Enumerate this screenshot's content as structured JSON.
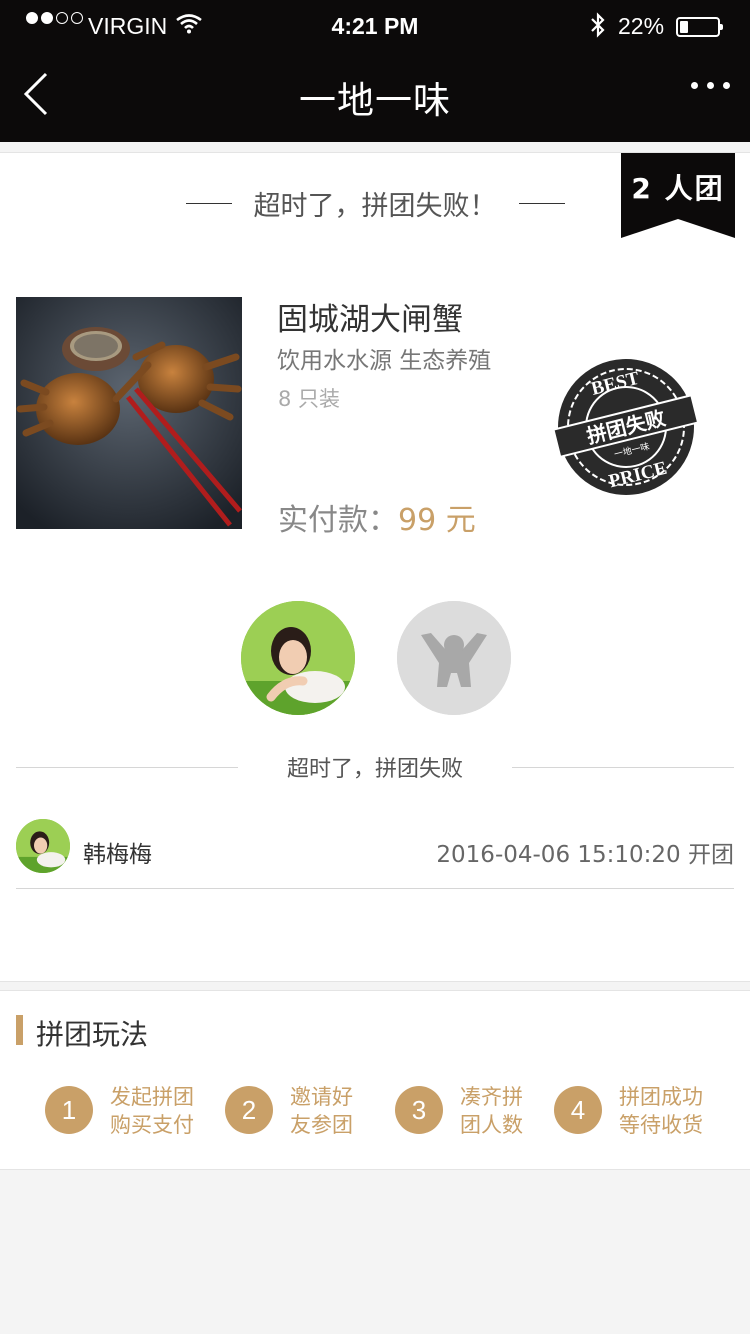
{
  "status_bar": {
    "carrier": "VIRGIN",
    "time": "4:21 PM",
    "battery": "22%",
    "battery_level": 0.22,
    "icons": [
      "signal-dots",
      "wifi-icon",
      "bluetooth-icon",
      "battery-icon"
    ]
  },
  "nav": {
    "title": "一地一味",
    "back_icon": "chevron-left-icon",
    "more_icon": "ellipsis-icon"
  },
  "group": {
    "heading": "超时了，拼团失败！",
    "team_badge": "2 人团"
  },
  "product": {
    "name": "固城湖大闸蟹",
    "description": "饮用水水源 生态养殖",
    "quantity": "8 只装",
    "paid_label": "实付款：",
    "paid_amount": "99 元",
    "stamp": {
      "top": "BEST",
      "middle": "拼团失败",
      "bottom": "PRICE",
      "small": "一地一味"
    }
  },
  "status_divider": "超时了，拼团失败",
  "member": {
    "name": "韩梅梅",
    "time": "2016-04-06 15:10:20 开团"
  },
  "rules": {
    "title": "拼团玩法",
    "steps": [
      {
        "num": "1",
        "line1": "发起拼团",
        "line2": "购买支付"
      },
      {
        "num": "2",
        "line1": "邀请好",
        "line2": "友参团"
      },
      {
        "num": "3",
        "line1": "凑齐拼",
        "line2": "团人数"
      },
      {
        "num": "4",
        "line1": "拼团成功",
        "line2": "等待收货"
      }
    ]
  },
  "colors": {
    "accent": "#c9a068",
    "header_bg": "#0c0a0a",
    "page_bg": "#f4f4f4"
  }
}
